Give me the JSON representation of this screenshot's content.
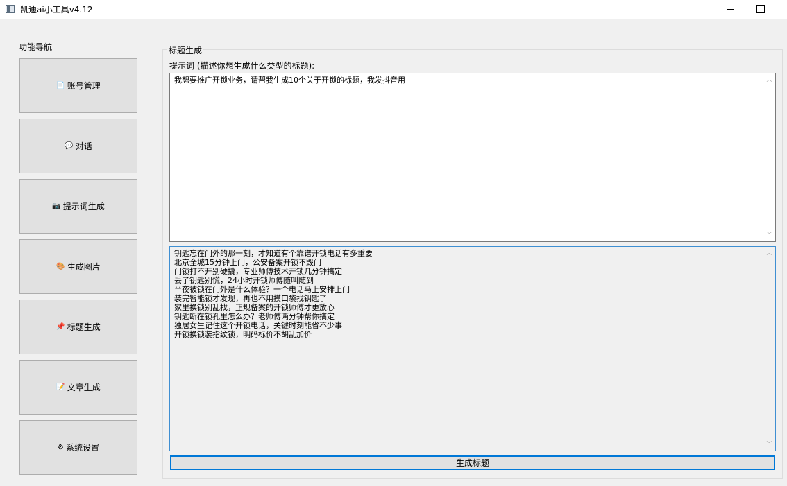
{
  "window": {
    "title": "凯迪ai小工具v4.12"
  },
  "sidebar": {
    "title": "功能导航",
    "items": [
      {
        "icon": "📄",
        "label": "账号管理"
      },
      {
        "icon": "💬",
        "label": "对话"
      },
      {
        "icon": "📷",
        "label": "提示词生成"
      },
      {
        "icon": "🎨",
        "label": "生成图片"
      },
      {
        "icon": "📌",
        "label": "标题生成"
      },
      {
        "icon": "📝",
        "label": "文章生成"
      },
      {
        "icon": "⚙",
        "label": "系统设置"
      }
    ]
  },
  "main": {
    "group_title": "标题生成",
    "prompt_label": "提示词 (描述你想生成什么类型的标题):",
    "prompt_value": "我想要推广开锁业务，请帮我生成10个关于开锁的标题，我发抖音用",
    "output_lines": [
      "钥匙忘在门外的那一刻，才知道有个靠谱开锁电话有多重要",
      "北京全城15分钟上门，公安备案开锁不毁门",
      "门锁打不开别硬撬，专业师傅技术开锁几分钟搞定",
      "丢了钥匙别慌，24小时开锁师傅随叫随到",
      "半夜被锁在门外是什么体验？一个电话马上安排上门",
      "装完智能锁才发现，再也不用摸口袋找钥匙了",
      "家里换锁别乱找，正规备案的开锁师傅才更放心",
      "钥匙断在锁孔里怎么办？老师傅两分钟帮你搞定",
      "独居女生记住这个开锁电话，关键时刻能省不少事",
      "开锁换锁装指纹锁，明码标价不胡乱加价"
    ],
    "generate_label": "生成标题"
  }
}
